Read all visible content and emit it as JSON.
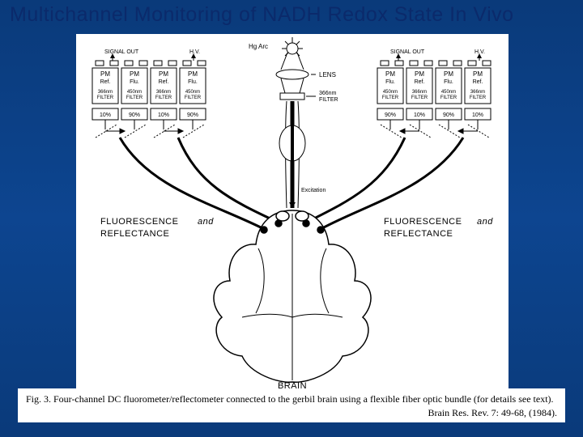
{
  "title": "Multichannel Monitoring of NADH Redox State In Vivo",
  "diagram": {
    "source_label": "Hg Arc",
    "lens_label": "LENS",
    "filter_label": "366 nm FILTER",
    "excitation_label": "Excitation",
    "brain_label": "BRAIN",
    "fr_label_a": "FLUORESCENCE",
    "fr_label_b": "and",
    "fr_label_c": "REFLECTANCE",
    "signal_out": "SIGNAL OUT",
    "hv": "H.V.",
    "pm": "PM",
    "ref": "Ref.",
    "flu": "Flu.",
    "filter_word": "FILTER",
    "filter_366": "366nm",
    "filter_450": "450nm",
    "pct10": "10%",
    "pct90": "90%"
  },
  "left_bank": {
    "pm": [
      {
        "line2": "Ref.",
        "filter_nm": "366nm",
        "split_left": "10%",
        "split_right": "90%"
      },
      {
        "line2": "Flu.",
        "filter_nm": "450nm",
        "split_left": "10%",
        "split_right": "90%"
      },
      {
        "line2": "Ref.",
        "filter_nm": "366nm",
        "split_left": "10%",
        "split_right": "90%"
      },
      {
        "line2": "Flu.",
        "filter_nm": "450nm",
        "split_left": "10%",
        "split_right": "90%"
      }
    ]
  },
  "right_bank": {
    "pm": [
      {
        "line2": "Flu.",
        "filter_nm": "450nm",
        "split_left": "90%",
        "split_right": "10%"
      },
      {
        "line2": "Ref.",
        "filter_nm": "366nm",
        "split_left": "90%",
        "split_right": "10%"
      },
      {
        "line2": "Flu.",
        "filter_nm": "450nm",
        "split_left": "90%",
        "split_right": "10%"
      },
      {
        "line2": "Ref.",
        "filter_nm": "366nm",
        "split_left": "90%",
        "split_right": "10%"
      }
    ]
  },
  "caption": {
    "text": "Fig. 3. Four-channel DC fluorometer/reflectometer connected to the gerbil brain using a flexible fiber optic bundle (for details see text).",
    "citation": "Brain Res. Rev. 7: 49-68, (1984)."
  }
}
